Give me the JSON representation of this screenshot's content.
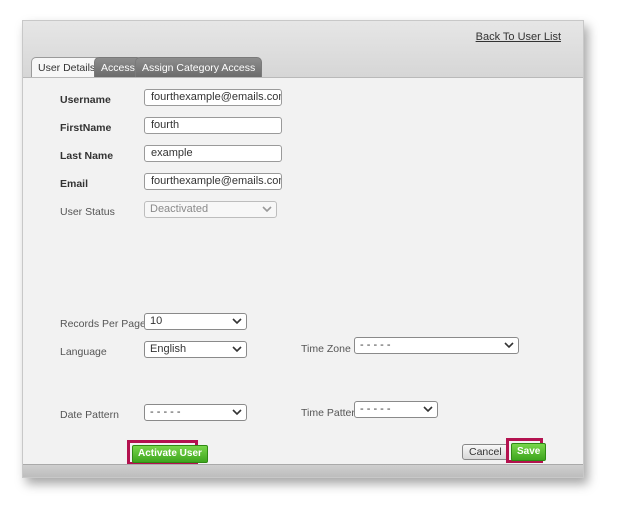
{
  "header": {
    "back_link": "Back To User List"
  },
  "tabs": [
    {
      "label": "User Details",
      "active": true
    },
    {
      "label": "Access",
      "active": false
    },
    {
      "label": "Assign Category Access",
      "active": false
    }
  ],
  "form": {
    "username": {
      "label": "Username",
      "value": "fourthexample@emails.com"
    },
    "firstname": {
      "label": "FirstName",
      "value": "fourth"
    },
    "lastname": {
      "label": "Last Name",
      "value": "example"
    },
    "email": {
      "label": "Email",
      "value": "fourthexample@emails.com"
    },
    "user_status": {
      "label": "User Status",
      "value": "Deactivated"
    },
    "records_per_page": {
      "label": "Records Per Page",
      "value": "10"
    },
    "language": {
      "label": "Language",
      "value": "English"
    },
    "time_zone": {
      "label": "Time Zone",
      "value": "- - - - -"
    },
    "date_pattern": {
      "label": "Date Pattern",
      "value": "- - - - -"
    },
    "time_pattern": {
      "label": "Time Pattern",
      "value": "- - - - -"
    }
  },
  "buttons": {
    "activate": "Activate User",
    "cancel": "Cancel",
    "save": "Save"
  },
  "colors": {
    "highlight": "#b3124f",
    "green": "#3ea51e"
  }
}
